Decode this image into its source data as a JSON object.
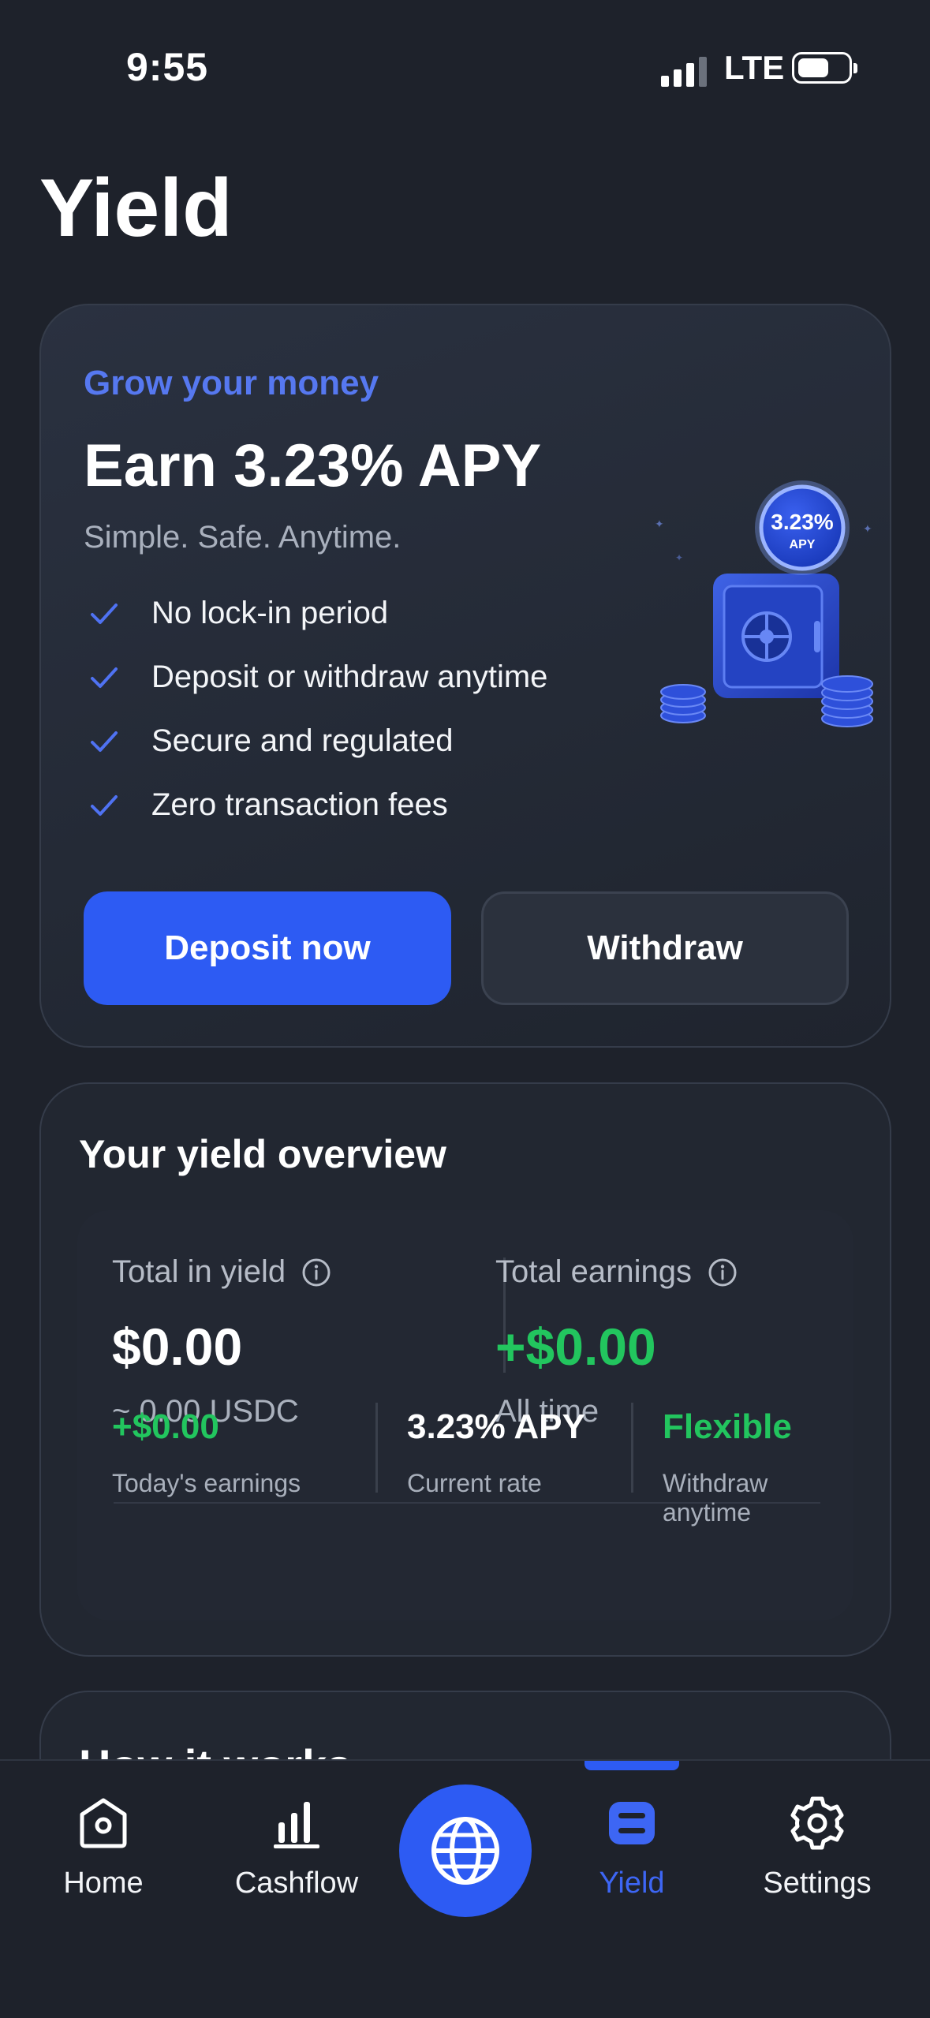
{
  "status_bar": {
    "time": "9:55",
    "network": "LTE"
  },
  "page": {
    "title": "Yield"
  },
  "promo": {
    "eyebrow": "Grow your money",
    "headline": "Earn 3.23% APY",
    "subhead": "Simple. Safe. Anytime.",
    "features": [
      "No lock-in period",
      "Deposit or withdraw anytime",
      "Secure and regulated",
      "Zero transaction fees"
    ],
    "badge_rate": "3.23%",
    "badge_label": "APY",
    "primary_button": "Deposit now",
    "secondary_button": "Withdraw"
  },
  "overview": {
    "title": "Your yield overview",
    "total_in_yield_label": "Total in yield",
    "total_in_yield_value": "$0.00",
    "total_in_yield_sub": "~ 0.00 USDC",
    "total_earnings_label": "Total earnings",
    "total_earnings_value": "+$0.00",
    "total_earnings_sub": "All time",
    "todays_earnings_value": "+$0.00",
    "todays_earnings_label": "Today's earnings",
    "current_rate_value": "3.23% APY",
    "current_rate_label": "Current rate",
    "flexible_value": "Flexible",
    "flexible_label": "Withdraw anytime"
  },
  "how_it_works": {
    "title": "How it works"
  },
  "tab_bar": {
    "home": "Home",
    "cashflow": "Cashflow",
    "yield": "Yield",
    "settings": "Settings",
    "active": "Yield"
  },
  "colors": {
    "background": "#1e222b",
    "accent": "#2d5bf3",
    "accent_text": "#5678f0",
    "positive": "#22c55e"
  }
}
